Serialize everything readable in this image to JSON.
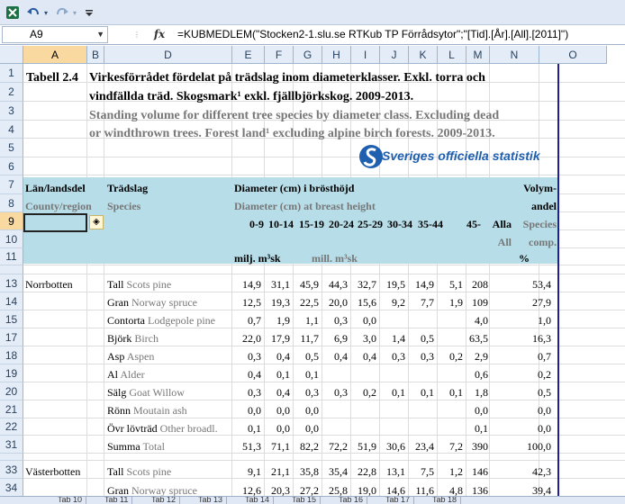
{
  "toolbar": {
    "icons": [
      "excel-logo-icon",
      "undo-icon",
      "undo-dropdown-icon",
      "redo-icon",
      "redo-dropdown-icon",
      "customize-toolbar-icon"
    ]
  },
  "formula_bar": {
    "name_box": "A9",
    "fx_label": "fx",
    "formula": "=KUBMEDLEM(\"Stocken2-1.slu.se RTKub TP Förrådsytor\";\"[Tid].[År].[All].[2011]\")"
  },
  "columns": [
    "A",
    "B",
    "D",
    "E",
    "F",
    "G",
    "H",
    "I",
    "J",
    "K",
    "L",
    "M",
    "N",
    "O"
  ],
  "selected_column": "A",
  "rows": [
    "1",
    "2",
    "3",
    "4",
    "5",
    "6",
    "7",
    "8",
    "9",
    "10",
    "11",
    "12",
    "13",
    "14",
    "15",
    "17",
    "18",
    "19",
    "20",
    "21",
    "22",
    "31",
    "32",
    "33",
    "34"
  ],
  "selected_row": "9",
  "title": {
    "label": "Tabell 2.4",
    "sv_line1": "Virkesförrådet fördelat på trädslag inom diameterklasser. Exkl. torra och",
    "sv_line2": "vindfällda träd. Skogsmark¹  exkl. fjällbjörkskog. 2009-2013.",
    "en_line1": "Standing volume for different tree species by diameter class. Excluding dead",
    "en_line2": "or windthrown trees. Forest land¹ excluding alpine birch forests. 2009-2013."
  },
  "logo_text": "Sveriges officiella statistik",
  "header": {
    "county_sv": "Län/landsdel",
    "county_en": "County/region",
    "species_sv": "Trädslag",
    "species_en": "Species",
    "diameter_sv": "Diameter (cm) i brösthöjd",
    "diameter_en": "Diameter (cm) at breast height",
    "classes": [
      "0-9",
      "10-14",
      "15-19",
      "20-24",
      "25-29",
      "30-34",
      "35-44",
      "45-",
      "Alla"
    ],
    "all_en": "All",
    "volume_sv": "Volym-",
    "volume_sv2": "andel",
    "volume_en": "Species",
    "volume_en2": "comp.",
    "unit_sv": "milj. m³sk",
    "unit_en": "mill. m³sk",
    "pct": "%"
  },
  "regions": [
    {
      "name": "Norrbotten",
      "species": [
        {
          "sv": "Tall",
          "en": "Scots pine",
          "values": [
            "14,9",
            "31,1",
            "45,9",
            "44,3",
            "32,7",
            "19,5",
            "14,9",
            "5,1",
            "208",
            "53,4"
          ]
        },
        {
          "sv": "Gran",
          "en": "Norway spruce",
          "values": [
            "12,5",
            "19,3",
            "22,5",
            "20,0",
            "15,6",
            "9,2",
            "7,7",
            "1,9",
            "109",
            "27,9"
          ]
        },
        {
          "sv": "Contorta",
          "en": "Lodgepole pine",
          "values": [
            "0,7",
            "1,9",
            "1,1",
            "0,3",
            "0,0",
            "",
            "",
            "",
            "4,0",
            "1,0"
          ]
        },
        {
          "sv": "Björk",
          "en": "Birch",
          "values": [
            "22,0",
            "17,9",
            "11,7",
            "6,9",
            "3,0",
            "1,4",
            "0,5",
            "",
            "63,5",
            "16,3"
          ]
        },
        {
          "sv": "Asp",
          "en": "Aspen",
          "values": [
            "0,3",
            "0,4",
            "0,5",
            "0,4",
            "0,4",
            "0,3",
            "0,3",
            "0,2",
            "2,9",
            "0,7"
          ]
        },
        {
          "sv": "Al",
          "en": "Alder",
          "values": [
            "0,4",
            "0,1",
            "0,1",
            "",
            "",
            "",
            "",
            "",
            "0,6",
            "0,2"
          ]
        },
        {
          "sv": "Sälg",
          "en": "Goat Willow",
          "values": [
            "0,3",
            "0,4",
            "0,3",
            "0,3",
            "0,2",
            "0,1",
            "0,1",
            "0,1",
            "1,8",
            "0,5"
          ]
        },
        {
          "sv": "Rönn",
          "en": "Moutain ash",
          "values": [
            "0,0",
            "0,0",
            "0,0",
            "",
            "",
            "",
            "",
            "",
            "0,0",
            "0,0"
          ]
        },
        {
          "sv": "Övr lövträd",
          "en": "Other broadl.",
          "values": [
            "0,1",
            "0,0",
            "0,0",
            "",
            "",
            "",
            "",
            "",
            "0,1",
            "0,0"
          ]
        },
        {
          "sv": "Summa",
          "en": "Total",
          "values": [
            "51,3",
            "71,1",
            "82,2",
            "72,2",
            "51,9",
            "30,6",
            "23,4",
            "7,2",
            "390",
            "100,0"
          ]
        }
      ]
    },
    {
      "name": "Västerbotten",
      "species": [
        {
          "sv": "Tall",
          "en": "Scots pine",
          "values": [
            "9,1",
            "21,1",
            "35,8",
            "35,4",
            "22,8",
            "13,1",
            "7,5",
            "1,2",
            "146",
            "42,3"
          ]
        },
        {
          "sv": "Gran",
          "en": "Norway spruce",
          "values": [
            "12,6",
            "20,3",
            "27,2",
            "25,8",
            "19,0",
            "14,6",
            "11,6",
            "4,8",
            "136",
            "39,4"
          ]
        }
      ]
    }
  ],
  "sheet_tabs": [
    "Tab 10",
    "Tab 11",
    "Tab 12",
    "Tab 13",
    "Tab 14",
    "Tab 15",
    "Tab 16",
    "Tab 17",
    "Tab 18"
  ]
}
